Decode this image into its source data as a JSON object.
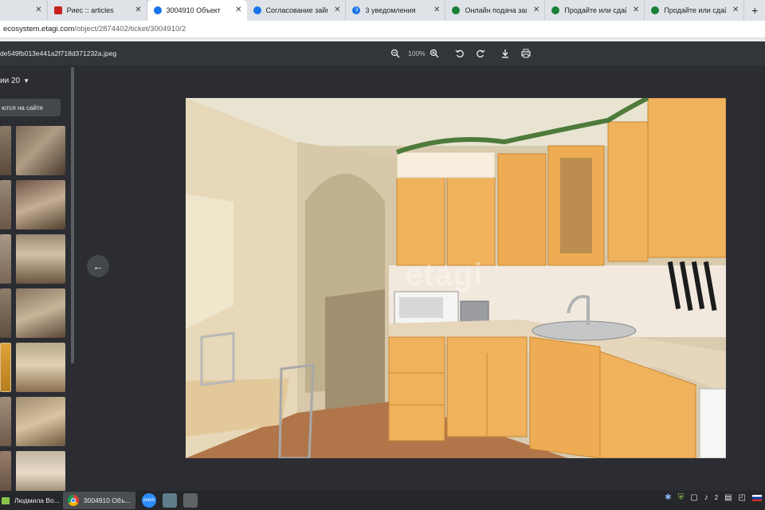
{
  "tabs": [
    {
      "title": "",
      "active": false,
      "fav_color": "#9aa0a6"
    },
    {
      "title": "Риес :: articles",
      "active": false,
      "fav_color": "#c5221f"
    },
    {
      "title": "3004910 Объект",
      "active": true,
      "fav_color": "#1a73e8"
    },
    {
      "title": "Согласование займа Гл",
      "active": false,
      "fav_color": "#1a73e8"
    },
    {
      "title": "3 уведомления",
      "active": false,
      "fav_color": "#1a73e8",
      "fav_text": "3"
    },
    {
      "title": "Онлайн подача заявки",
      "active": false,
      "fav_color": "#188038"
    },
    {
      "title": "Продайте или сдайте в",
      "active": false,
      "fav_color": "#188038"
    },
    {
      "title": "Продайте или сдайте в",
      "active": false,
      "fav_color": "#188038"
    }
  ],
  "address": {
    "domain": "ecosystem.etagi.com",
    "path": "/object/2874402/ticket/3004910/2"
  },
  "viewer": {
    "filename": "de549fb013e441a2f718d371232a.jpeg",
    "zoom": "100%"
  },
  "panel": {
    "photo_count_label": "ии 20",
    "visible_label": "ются на сайте"
  },
  "photo": {
    "watermark": "etagi"
  },
  "taskbar": {
    "user_label": "Людмила Во...",
    "chrome_label": "3004910 Объ...",
    "zoom_label": "zoom",
    "tray_count": "2"
  }
}
